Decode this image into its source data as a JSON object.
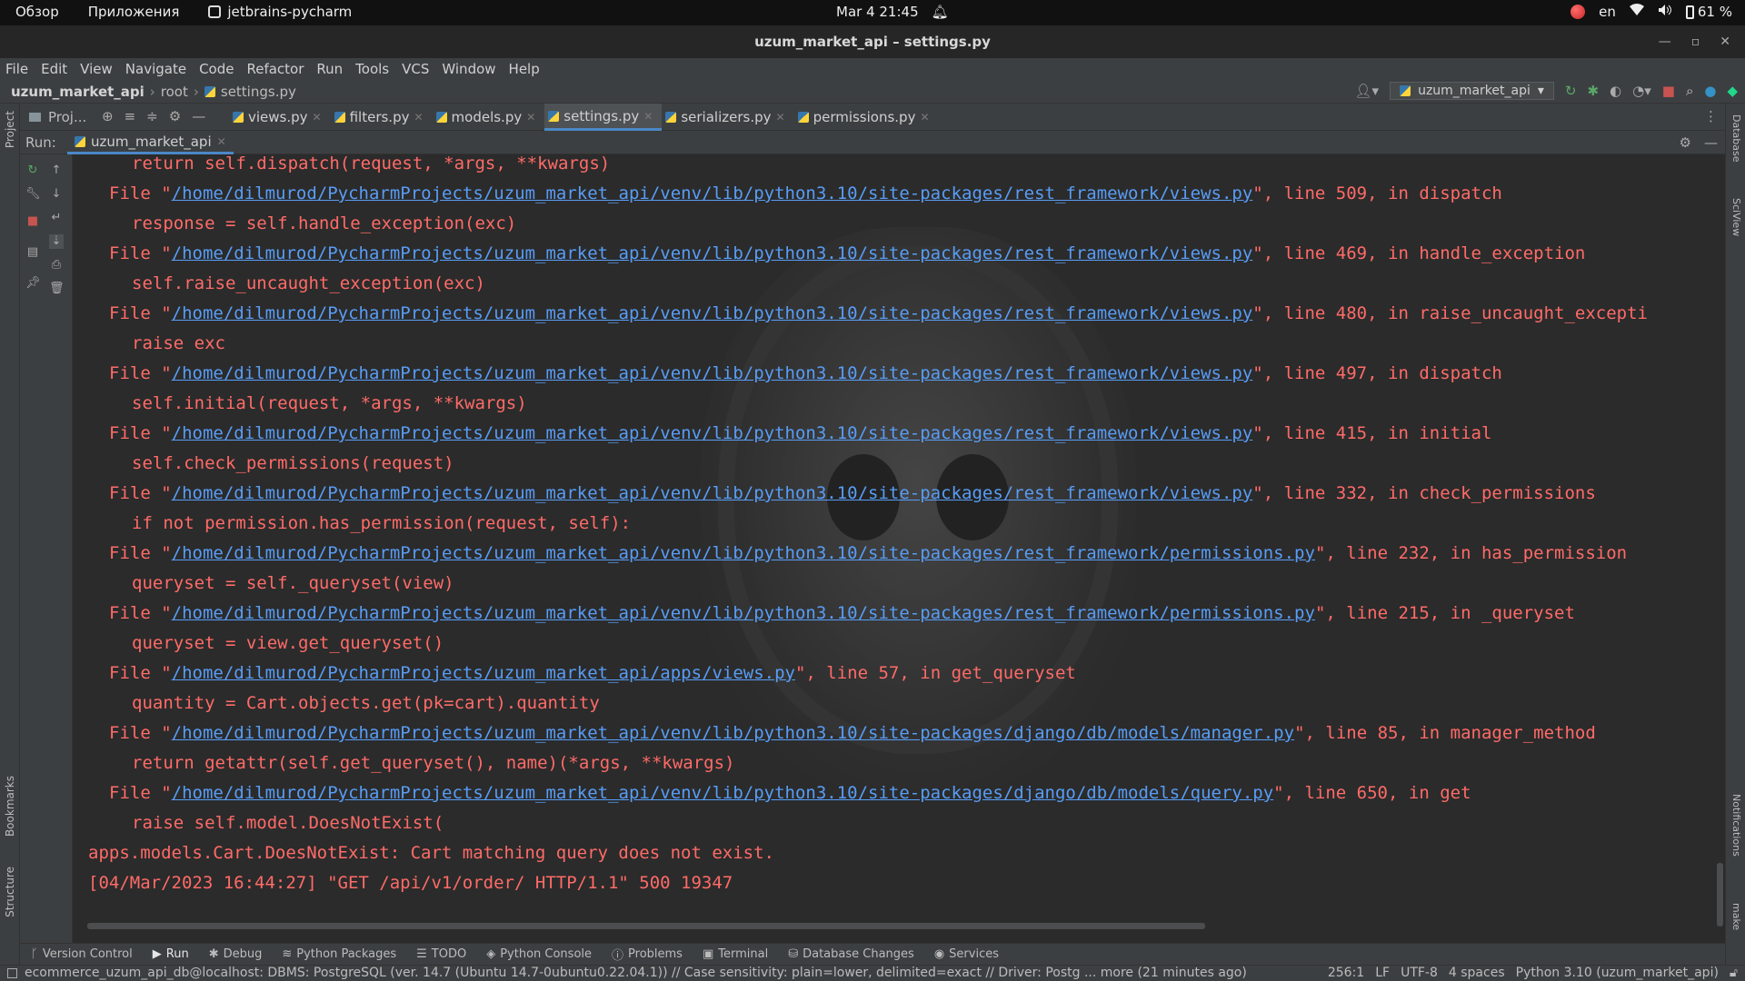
{
  "topbar": {
    "overview": "Обзор",
    "applications": "Приложения",
    "app_name": "jetbrains-pycharm",
    "clock": "Mar 4  21:45",
    "lang": "en",
    "battery": "61 %"
  },
  "window": {
    "title": "uzum_market_api – settings.py"
  },
  "menu": [
    "File",
    "Edit",
    "View",
    "Navigate",
    "Code",
    "Refactor",
    "Run",
    "Tools",
    "VCS",
    "Window",
    "Help"
  ],
  "breadcrumb": {
    "project": "uzum_market_api",
    "folder": "root",
    "file": "settings.py"
  },
  "run_config": {
    "name": "uzum_market_api"
  },
  "tabs_bar": {
    "project_label": "Proj...",
    "tabs": [
      {
        "label": "views.py"
      },
      {
        "label": "filters.py"
      },
      {
        "label": "models.py"
      },
      {
        "label": "settings.py"
      },
      {
        "label": "serializers.py"
      },
      {
        "label": "permissions.py"
      }
    ]
  },
  "side_labels": {
    "project": "Project",
    "bookmarks": "Bookmarks",
    "structure": "Structure",
    "database": "Database",
    "sciview": "SciView",
    "notifications": "Notifications",
    "make": "make"
  },
  "run_panel": {
    "label": "Run:",
    "tab": "uzum_market_api"
  },
  "console": {
    "lines": [
      {
        "indent": 2,
        "pre": "return self.dispatch(request, *args, **kwargs)",
        "link": "",
        "post": ""
      },
      {
        "indent": 1,
        "pre": "File \"",
        "link": "/home/dilmurod/PycharmProjects/uzum_market_api/venv/lib/python3.10/site-packages/rest_framework/views.py",
        "post": "\", line 509, in dispatch"
      },
      {
        "indent": 2,
        "pre": "response = self.handle_exception(exc)",
        "link": "",
        "post": ""
      },
      {
        "indent": 1,
        "pre": "File \"",
        "link": "/home/dilmurod/PycharmProjects/uzum_market_api/venv/lib/python3.10/site-packages/rest_framework/views.py",
        "post": "\", line 469, in handle_exception"
      },
      {
        "indent": 2,
        "pre": "self.raise_uncaught_exception(exc)",
        "link": "",
        "post": ""
      },
      {
        "indent": 1,
        "pre": "File \"",
        "link": "/home/dilmurod/PycharmProjects/uzum_market_api/venv/lib/python3.10/site-packages/rest_framework/views.py",
        "post": "\", line 480, in raise_uncaught_excepti"
      },
      {
        "indent": 2,
        "pre": "raise exc",
        "link": "",
        "post": ""
      },
      {
        "indent": 1,
        "pre": "File \"",
        "link": "/home/dilmurod/PycharmProjects/uzum_market_api/venv/lib/python3.10/site-packages/rest_framework/views.py",
        "post": "\", line 497, in dispatch"
      },
      {
        "indent": 2,
        "pre": "self.initial(request, *args, **kwargs)",
        "link": "",
        "post": ""
      },
      {
        "indent": 1,
        "pre": "File \"",
        "link": "/home/dilmurod/PycharmProjects/uzum_market_api/venv/lib/python3.10/site-packages/rest_framework/views.py",
        "post": "\", line 415, in initial"
      },
      {
        "indent": 2,
        "pre": "self.check_permissions(request)",
        "link": "",
        "post": ""
      },
      {
        "indent": 1,
        "pre": "File \"",
        "link": "/home/dilmurod/PycharmProjects/uzum_market_api/venv/lib/python3.10/site-packages/rest_framework/views.py",
        "post": "\", line 332, in check_permissions"
      },
      {
        "indent": 2,
        "pre": "if not permission.has_permission(request, self):",
        "link": "",
        "post": ""
      },
      {
        "indent": 1,
        "pre": "File \"",
        "link": "/home/dilmurod/PycharmProjects/uzum_market_api/venv/lib/python3.10/site-packages/rest_framework/permissions.py",
        "post": "\", line 232, in has_permission"
      },
      {
        "indent": 2,
        "pre": "queryset = self._queryset(view)",
        "link": "",
        "post": ""
      },
      {
        "indent": 1,
        "pre": "File \"",
        "link": "/home/dilmurod/PycharmProjects/uzum_market_api/venv/lib/python3.10/site-packages/rest_framework/permissions.py",
        "post": "\", line 215, in _queryset"
      },
      {
        "indent": 2,
        "pre": "queryset = view.get_queryset()",
        "link": "",
        "post": ""
      },
      {
        "indent": 1,
        "pre": "File \"",
        "link": "/home/dilmurod/PycharmProjects/uzum_market_api/apps/views.py",
        "post": "\", line 57, in get_queryset"
      },
      {
        "indent": 2,
        "pre": "quantity = Cart.objects.get(pk=cart).quantity",
        "link": "",
        "post": ""
      },
      {
        "indent": 1,
        "pre": "File \"",
        "link": "/home/dilmurod/PycharmProjects/uzum_market_api/venv/lib/python3.10/site-packages/django/db/models/manager.py",
        "post": "\", line 85, in manager_method"
      },
      {
        "indent": 2,
        "pre": "return getattr(self.get_queryset(), name)(*args, **kwargs)",
        "link": "",
        "post": ""
      },
      {
        "indent": 1,
        "pre": "File \"",
        "link": "/home/dilmurod/PycharmProjects/uzum_market_api/venv/lib/python3.10/site-packages/django/db/models/query.py",
        "post": "\", line 650, in get"
      },
      {
        "indent": 2,
        "pre": "raise self.model.DoesNotExist(",
        "link": "",
        "post": ""
      },
      {
        "indent": 0,
        "pre": "apps.models.Cart.DoesNotExist: Cart matching query does not exist.",
        "link": "",
        "post": ""
      },
      {
        "indent": 0,
        "pre": "[04/Mar/2023 16:44:27] \"GET /api/v1/order/ HTTP/1.1\" 500 19347",
        "link": "",
        "post": ""
      }
    ]
  },
  "tool_windows": [
    {
      "label": "Version Control",
      "icon": "branch-icon",
      "active": false
    },
    {
      "label": "Run",
      "icon": "play-icon",
      "active": true
    },
    {
      "label": "Debug",
      "icon": "bug-icon",
      "active": false
    },
    {
      "label": "Python Packages",
      "icon": "layers-icon",
      "active": false
    },
    {
      "label": "TODO",
      "icon": "list-icon",
      "active": false
    },
    {
      "label": "Python Console",
      "icon": "console-icon",
      "active": false
    },
    {
      "label": "Problems",
      "icon": "info-icon",
      "active": false
    },
    {
      "label": "Terminal",
      "icon": "terminal-icon",
      "active": false
    },
    {
      "label": "Database Changes",
      "icon": "database-icon",
      "active": false
    },
    {
      "label": "Services",
      "icon": "services-icon",
      "active": false
    }
  ],
  "status": {
    "message": "ecommerce_uzum_api_db@localhost: DBMS: PostgreSQL (ver. 14.7 (Ubuntu 14.7-0ubuntu0.22.04.1)) // Case sensitivity: plain=lower, delimited=exact // Driver: Postg ... more (21 minutes ago)",
    "position": "256:1",
    "line_sep": "LF",
    "encoding": "UTF-8",
    "indent": "4 spaces",
    "interpreter": "Python 3.10 (uzum_market_api)"
  },
  "colors": {
    "error_text": "#ff6b68",
    "link": "#589df6",
    "accent": "#4a88c7",
    "background": "#2b2b2b",
    "panel": "#3c3f41"
  }
}
